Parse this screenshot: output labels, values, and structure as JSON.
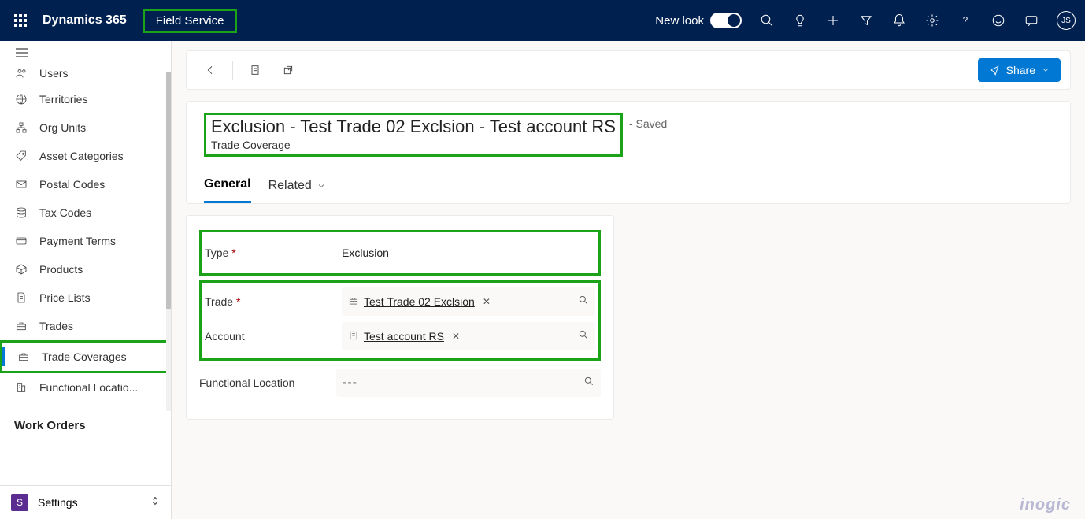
{
  "header": {
    "brand": "Dynamics 365",
    "app_name": "Field Service",
    "new_look_label": "New look",
    "avatar_initials": "JS"
  },
  "sidebar": {
    "items": [
      {
        "label": "Users"
      },
      {
        "label": "Territories"
      },
      {
        "label": "Org Units"
      },
      {
        "label": "Asset Categories"
      },
      {
        "label": "Postal Codes"
      },
      {
        "label": "Tax Codes"
      },
      {
        "label": "Payment Terms"
      },
      {
        "label": "Products"
      },
      {
        "label": "Price Lists"
      },
      {
        "label": "Trades"
      },
      {
        "label": "Trade Coverages"
      },
      {
        "label": "Functional Locatio..."
      }
    ],
    "section_title": "Work Orders",
    "area_letter": "S",
    "area_name": "Settings"
  },
  "commands": {
    "share_label": "Share"
  },
  "record": {
    "title": "Exclusion - Test Trade 02 Exclsion - Test account RS",
    "subtitle": "Trade Coverage",
    "saved_suffix": "- Saved",
    "tabs": {
      "general": "General",
      "related": "Related"
    }
  },
  "form": {
    "type_label": "Type",
    "type_value": "Exclusion",
    "trade_label": "Trade",
    "trade_value": "Test Trade 02 Exclsion",
    "account_label": "Account",
    "account_value": "Test account RS",
    "funcloc_label": "Functional Location",
    "funcloc_placeholder": "---"
  },
  "watermark": "inogic"
}
